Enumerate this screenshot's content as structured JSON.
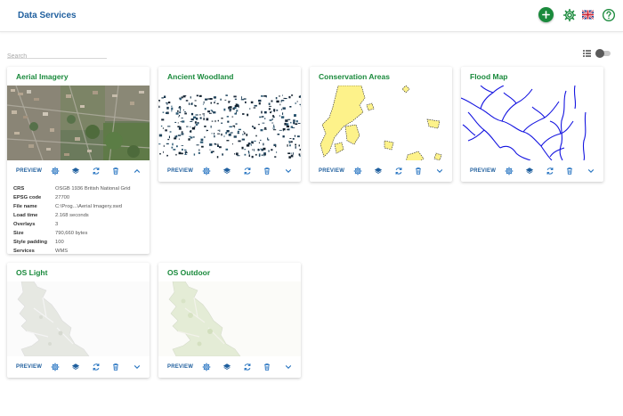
{
  "header": {
    "title": "Data Services"
  },
  "search": {
    "placeholder": "Search"
  },
  "icons": {
    "add": "plus-icon",
    "settings": "gear-icon",
    "language": "uk-flag-icon",
    "help": "help-icon",
    "view_list": "list-icon",
    "view_toggle": "toggle-icon"
  },
  "colors": {
    "accent_green": "#1a8a3c",
    "link_blue": "#1f5f9e",
    "action_blue": "#1f6fbf"
  },
  "card_actions": {
    "preview_label": "PREVIEW"
  },
  "cards": [
    {
      "title": "Aerial Imagery",
      "expanded": true
    },
    {
      "title": "Ancient Woodland",
      "expanded": false
    },
    {
      "title": "Conservation Areas",
      "expanded": false
    },
    {
      "title": "Flood Map",
      "expanded": false
    },
    {
      "title": "OS Light",
      "expanded": false
    },
    {
      "title": "OS Outdoor",
      "expanded": false
    }
  ],
  "details": [
    {
      "key": "CRS",
      "value": "OSGB 1936 British National Grid"
    },
    {
      "key": "EPSG code",
      "value": "27700"
    },
    {
      "key": "File name",
      "value": "C:\\Prog...\\Aerial Imagery.swd"
    },
    {
      "key": "Load time",
      "value": "2.168 seconds"
    },
    {
      "key": "Overlays",
      "value": "3"
    },
    {
      "key": "Size",
      "value": "790,660 bytes"
    },
    {
      "key": "Style padding",
      "value": "100"
    },
    {
      "key": "Services",
      "value": "WMS"
    }
  ]
}
